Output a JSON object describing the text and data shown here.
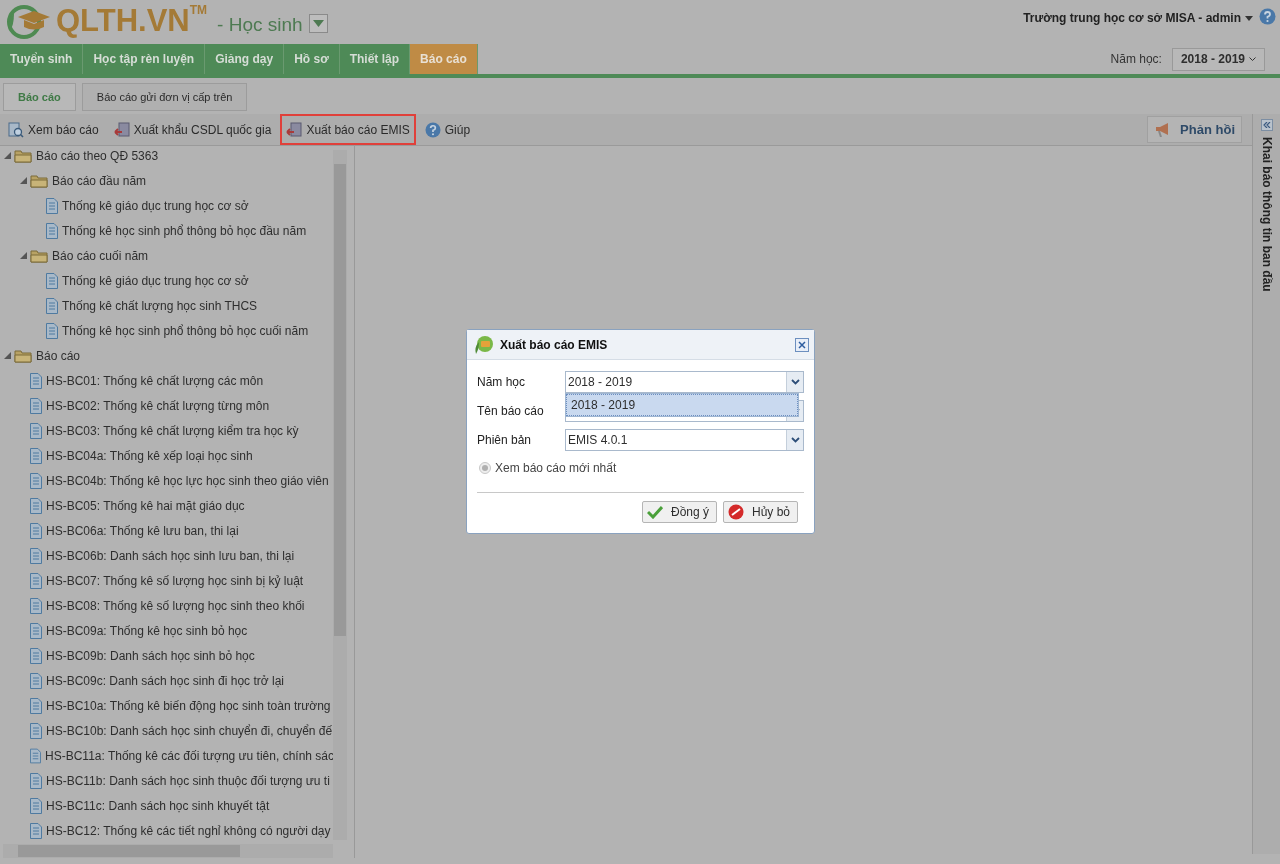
{
  "header": {
    "logo_text": "QLTH.VN",
    "trademark": "TM",
    "module": "- Học sinh",
    "user": "Trường trung học cơ sở MISA - admin",
    "year_label": "Năm học:",
    "year_value": "2018 - 2019"
  },
  "nav_tabs": [
    {
      "label": "Tuyển sinh",
      "selected": false
    },
    {
      "label": "Học tập rèn luyện",
      "selected": false
    },
    {
      "label": "Giảng dạy",
      "selected": false
    },
    {
      "label": "Hồ sơ",
      "selected": false
    },
    {
      "label": "Thiết lập",
      "selected": false
    },
    {
      "label": "Báo cáo",
      "selected": true
    }
  ],
  "sub_tabs": [
    {
      "label": "Báo cáo",
      "selected": true
    },
    {
      "label": "Báo cáo gửi đơn vị cấp trên",
      "selected": false
    }
  ],
  "toolbar": [
    {
      "label": "Xem báo cáo",
      "kind": "view",
      "highlighted": false
    },
    {
      "label": "Xuất khẩu CSDL quốc gia",
      "kind": "export",
      "highlighted": false
    },
    {
      "label": "Xuất báo cáo EMIS",
      "kind": "export",
      "highlighted": true
    },
    {
      "label": "Giúp",
      "kind": "help",
      "highlighted": false
    }
  ],
  "feedback_button": "Phản hồi",
  "tree": [
    {
      "label": "Báo cáo theo QĐ 5363",
      "kind": "folder",
      "expanded": true,
      "children": [
        {
          "label": "Báo cáo đầu năm",
          "kind": "folder",
          "expanded": true,
          "children": [
            {
              "label": "Thống kê giáo dục trung học cơ sở",
              "kind": "report"
            },
            {
              "label": "Thống kê học sinh phổ thông bỏ học đầu năm",
              "kind": "report"
            }
          ]
        },
        {
          "label": "Báo cáo cuối năm",
          "kind": "folder",
          "expanded": true,
          "children": [
            {
              "label": "Thống kê giáo dục trung học cơ sở",
              "kind": "report"
            },
            {
              "label": "Thống kê chất lượng học sinh THCS",
              "kind": "report"
            },
            {
              "label": "Thống kê học sinh phổ thông bỏ học cuối năm",
              "kind": "report"
            }
          ]
        }
      ]
    },
    {
      "label": "Báo cáo",
      "kind": "folder",
      "expanded": true,
      "children": [
        {
          "label": "HS-BC01: Thống kê chất lượng các môn",
          "kind": "report"
        },
        {
          "label": "HS-BC02: Thống kê chất lượng từng môn",
          "kind": "report"
        },
        {
          "label": "HS-BC03: Thống kê chất lượng kiểm tra học kỳ",
          "kind": "report"
        },
        {
          "label": "HS-BC04a: Thống kê xếp loại học sinh",
          "kind": "report"
        },
        {
          "label": "HS-BC04b: Thống kê học lực học sinh theo giáo viên",
          "kind": "report"
        },
        {
          "label": "HS-BC05: Thống kê hai mặt giáo dục",
          "kind": "report"
        },
        {
          "label": "HS-BC06a: Thống kê lưu ban, thi lại",
          "kind": "report"
        },
        {
          "label": "HS-BC06b: Danh sách học sinh lưu ban, thi lại",
          "kind": "report"
        },
        {
          "label": "HS-BC07: Thống kê số lượng học sinh bị kỷ luật",
          "kind": "report"
        },
        {
          "label": "HS-BC08: Thống kê số lượng học sinh theo khối",
          "kind": "report"
        },
        {
          "label": "HS-BC09a: Thống kê học sinh bỏ học",
          "kind": "report"
        },
        {
          "label": "HS-BC09b: Danh sách học sinh bỏ học",
          "kind": "report"
        },
        {
          "label": "HS-BC09c: Danh sách học sinh đi học trở lại",
          "kind": "report"
        },
        {
          "label": "HS-BC10a: Thống kê biến động học sinh toàn trường",
          "kind": "report"
        },
        {
          "label": "HS-BC10b: Danh sách học sinh chuyển đi, chuyển đế",
          "kind": "report"
        },
        {
          "label": "HS-BC11a: Thống kê các đối tượng ưu tiên, chính sác",
          "kind": "report"
        },
        {
          "label": "HS-BC11b: Danh sách học sinh thuộc đối tượng ưu ti",
          "kind": "report"
        },
        {
          "label": "HS-BC11c: Danh sách học sinh khuyết tật",
          "kind": "report"
        },
        {
          "label": "HS-BC12: Thống kê các tiết nghỉ không có người dạy",
          "kind": "report"
        }
      ]
    }
  ],
  "side_panel": {
    "title": "Khai báo thông tin ban đầu"
  },
  "dialog": {
    "title": "Xuất báo cáo EMIS",
    "fields": [
      {
        "label": "Năm học",
        "value": "2018 - 2019"
      },
      {
        "label": "Tên báo cáo"
      },
      {
        "label": "Phiên bản",
        "value": "EMIS 4.0.1"
      }
    ],
    "dropdown_options": [
      {
        "label": "2018 - 2019",
        "selected": true
      }
    ],
    "radio": {
      "label": "Xem báo cáo mới nhất",
      "checked": true,
      "disabled": true
    },
    "buttons": [
      {
        "label": "Đồng ý",
        "kind": "ok"
      },
      {
        "label": "Hủy bỏ",
        "kind": "cancel"
      }
    ]
  }
}
